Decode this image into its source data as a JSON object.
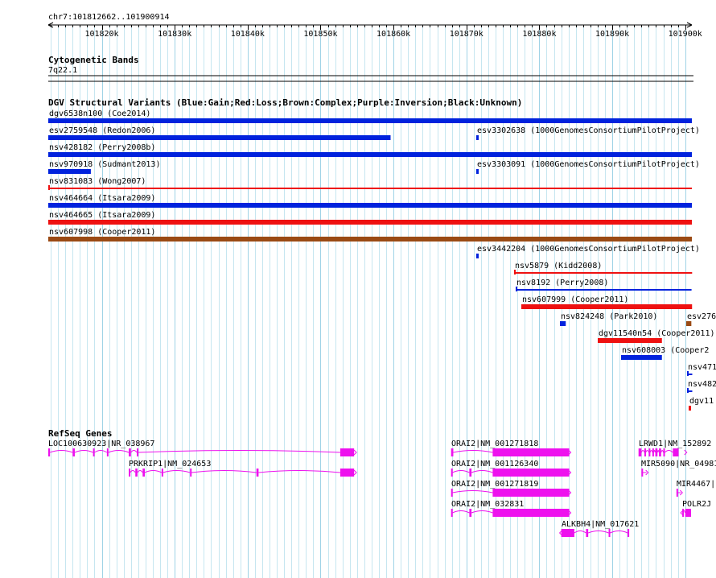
{
  "ruler": {
    "label": "chr7:101812662..101900914",
    "ticks": [
      "101820k",
      "101830k",
      "101840k",
      "101850k",
      "101860k",
      "101870k",
      "101880k",
      "101890k",
      "101900k"
    ]
  },
  "tracks": {
    "cytoband": {
      "title": "Cytogenetic Bands",
      "band": "7q22.1"
    },
    "dgv": {
      "title": "DGV Structural Variants (Blue:Gain;Red:Loss;Brown:Complex;Purple:Inversion;Black:Unknown)"
    },
    "refseq": {
      "title": "RefSeq Genes"
    }
  },
  "colors": {
    "grid": "#c6e6f0",
    "gain": "#0022dd",
    "loss": "#ee1111",
    "complex": "#9a4a14",
    "gene": "#ee11ee",
    "axis": "#000000"
  },
  "variants": [
    {
      "label": "dgv6538n100 (Coe2014)",
      "start": 101812662,
      "end": 101900914,
      "type": "gain",
      "style": "thick"
    },
    {
      "label": "esv2759548 (Redon2006)",
      "start": 101812662,
      "end": 101859600,
      "type": "gain",
      "style": "thick"
    },
    {
      "label": "esv3302638 (1000GenomesConsortiumPilotProject)",
      "start": 101871300,
      "end": 101871600,
      "type": "gain",
      "style": "thick"
    },
    {
      "label": "nsv428182 (Perry2008b)",
      "start": 101812662,
      "end": 101900914,
      "type": "gain",
      "style": "thick"
    },
    {
      "label": "nsv970918 (Sudmant2013)",
      "start": 101812662,
      "end": 101818500,
      "type": "gain",
      "style": "thick"
    },
    {
      "label": "esv3303091 (1000GenomesConsortiumPilotProject)",
      "start": 101871300,
      "end": 101871600,
      "type": "gain",
      "style": "thick"
    },
    {
      "label": "nsv831083 (Wong2007)",
      "start": 101812662,
      "end": 101900914,
      "type": "loss",
      "style": "thin"
    },
    {
      "label": "nsv464664 (Itsara2009)",
      "start": 101812662,
      "end": 101900914,
      "type": "gain",
      "style": "thick"
    },
    {
      "label": "nsv464665 (Itsara2009)",
      "start": 101812662,
      "end": 101900914,
      "type": "loss",
      "style": "thick"
    },
    {
      "label": "nsv607998 (Cooper2011)",
      "start": 101812662,
      "end": 101900914,
      "type": "complex",
      "style": "thick"
    },
    {
      "label": "esv3442204 (1000GenomesConsortiumPilotProject)",
      "start": 101871300,
      "end": 101871500,
      "type": "gain",
      "style": "thick"
    },
    {
      "label": "nsv5879 (Kidd2008)",
      "start": 101876500,
      "end": 101900914,
      "type": "loss",
      "style": "thin"
    },
    {
      "label": "nsv8192 (Perry2008)",
      "start": 101876800,
      "end": 101900914,
      "type": "gain",
      "style": "thin"
    },
    {
      "label": "nsv607999 (Cooper2011)",
      "start": 101877500,
      "end": 101900914,
      "type": "loss",
      "style": "thick"
    },
    {
      "label": "nsv824248 (Park2010)",
      "start": 101882800,
      "end": 101883600,
      "type": "gain",
      "style": "thick"
    },
    {
      "label": "esv276",
      "start": 101900100,
      "end": 101900800,
      "type": "complex",
      "style": "thick"
    },
    {
      "label": "dgv11540n54 (Cooper2011)",
      "start": 101888000,
      "end": 101896800,
      "type": "loss",
      "style": "thick"
    },
    {
      "label": "nsv608003 (Cooper2",
      "start": 101891200,
      "end": 101896800,
      "type": "gain",
      "style": "thick"
    },
    {
      "label": "nsv471",
      "start": 101900200,
      "end": 101900914,
      "type": "gain",
      "style": "thin"
    },
    {
      "label": "nsv482",
      "start": 101900200,
      "end": 101900914,
      "type": "gain",
      "style": "thin"
    },
    {
      "label": "dgv11",
      "start": 101900500,
      "end": 101900800,
      "type": "loss",
      "style": "thick"
    }
  ],
  "genes": [
    {
      "label": "LOC100630923|NR_038967",
      "start": 101812662,
      "end": 101854700,
      "strand": "+",
      "exons": [
        [
          101812662,
          101812900
        ],
        [
          101816000,
          101816300
        ],
        [
          101818800,
          101819000
        ],
        [
          101820700,
          101820900
        ],
        [
          101823700,
          101824000
        ],
        [
          101824800,
          101825000
        ],
        [
          101852700,
          101854600
        ]
      ]
    },
    {
      "label": "PRKRIP1|NM_024653",
      "start": 101823700,
      "end": 101854700,
      "strand": "+",
      "exons": [
        [
          101823700,
          101823900
        ],
        [
          101824600,
          101824900
        ],
        [
          101825600,
          101825900
        ],
        [
          101828200,
          101828400
        ],
        [
          101832100,
          101832300
        ],
        [
          101841200,
          101841500
        ],
        [
          101852700,
          101854600
        ]
      ]
    },
    {
      "label": "ORAI2|NM_001271818",
      "start": 101867900,
      "end": 101884100,
      "strand": "+",
      "exons": [
        [
          101867900,
          101868200
        ],
        [
          101873600,
          101884100
        ]
      ]
    },
    {
      "label": "ORAI2|NM_001126340",
      "start": 101867900,
      "end": 101884100,
      "strand": "+",
      "exons": [
        [
          101867900,
          101868100
        ],
        [
          101870400,
          101870700
        ],
        [
          101873600,
          101884100
        ]
      ]
    },
    {
      "label": "ORAI2|NM_001271819",
      "start": 101867900,
      "end": 101884100,
      "strand": "+",
      "exons": [
        [
          101867900,
          101868100
        ],
        [
          101873600,
          101884100
        ]
      ]
    },
    {
      "label": "ORAI2|NM_032831",
      "start": 101867900,
      "end": 101884100,
      "strand": "+",
      "exons": [
        [
          101867900,
          101868100
        ],
        [
          101870400,
          101870700
        ],
        [
          101873600,
          101884100
        ]
      ]
    },
    {
      "label": "ALKBH4|NM_017621",
      "start": 101883000,
      "end": 101892300,
      "strand": "-",
      "exons": [
        [
          101883000,
          101884800
        ],
        [
          101886400,
          101886700
        ],
        [
          101889500,
          101889700
        ],
        [
          101892100,
          101892300
        ]
      ]
    },
    {
      "label": "LRWD1|NM_152892",
      "start": 101893600,
      "end": 101900000,
      "strand": "+",
      "exons": [
        [
          101893600,
          101894000
        ],
        [
          101894400,
          101894600
        ],
        [
          101895000,
          101895200
        ],
        [
          101895500,
          101895700
        ],
        [
          101895900,
          101896200
        ],
        [
          101896400,
          101896700
        ],
        [
          101897000,
          101897200
        ],
        [
          101898300,
          101899100
        ]
      ]
    },
    {
      "label": "MIR5090|NR_049813",
      "start": 101894000,
      "end": 101894700,
      "strand": "+",
      "exons": [
        [
          101894000,
          101894100
        ]
      ]
    },
    {
      "label": "MIR4467|",
      "start": 101898800,
      "end": 101899400,
      "strand": "+",
      "exons": [
        [
          101898800,
          101898900
        ]
      ]
    },
    {
      "label": "POLR2J",
      "start": 101899600,
      "end": 101900800,
      "strand": "-",
      "exons": [
        [
          101899600,
          101899700
        ],
        [
          101900000,
          101900800
        ]
      ]
    }
  ]
}
